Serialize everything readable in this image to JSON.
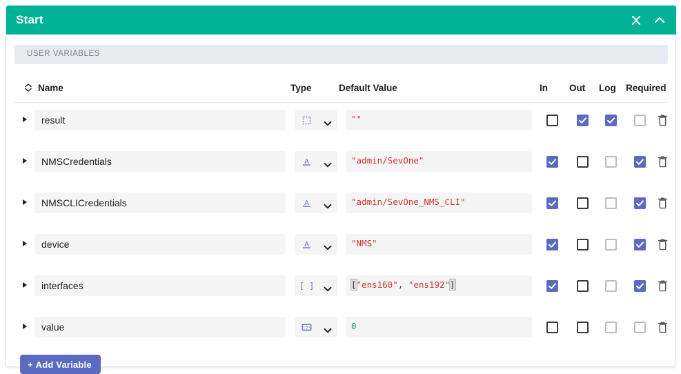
{
  "header": {
    "title": "Start",
    "accent_color": "#00b296",
    "collapse_all_icon": "collapse-all-icon",
    "collapse_panel_icon": "chevron-up-icon"
  },
  "section": {
    "label": "USER VARIABLES"
  },
  "columns": {
    "sort_icon": "sort-collapse-icon",
    "name": "Name",
    "type": "Type",
    "default_value": "Default Value",
    "in": "In",
    "out": "Out",
    "log": "Log",
    "required": "Required"
  },
  "colors": {
    "accent": "#00b296",
    "checkbox_checked": "#5c6bc0",
    "button": "#5c6bc0",
    "string_token": "#d0353a",
    "number_token": "#0f9d6e",
    "band": "#e8eaf2",
    "field": "#f5f5f5"
  },
  "rows": [
    {
      "name": "result",
      "type_icon": "type-any-icon",
      "value_tokens": [
        {
          "t": "str",
          "s": "\"\""
        }
      ],
      "value_text": "\"\"",
      "in": false,
      "out": true,
      "log": true,
      "required": false,
      "in_dim": false,
      "out_dim": false,
      "log_dim": false,
      "required_dim": true,
      "delete_icon": "trash-icon",
      "expand_icon": "expand-arrow-icon"
    },
    {
      "name": "NMSCredentials",
      "type_icon": "type-string-icon",
      "value_tokens": [
        {
          "t": "str",
          "s": "\"admin/SevOne\""
        }
      ],
      "value_text": "\"admin/SevOne\"",
      "in": true,
      "out": false,
      "log": false,
      "required": true,
      "in_dim": false,
      "out_dim": false,
      "log_dim": true,
      "required_dim": false,
      "delete_icon": "trash-icon",
      "expand_icon": "expand-arrow-icon"
    },
    {
      "name": "NMSCLICredentials",
      "type_icon": "type-string-icon",
      "value_tokens": [
        {
          "t": "str",
          "s": "\"admin/SevOne_NMS_CLI\""
        }
      ],
      "value_text": "\"admin/SevOne_NMS_CLI\"",
      "in": true,
      "out": false,
      "log": false,
      "required": true,
      "in_dim": false,
      "out_dim": false,
      "log_dim": true,
      "required_dim": false,
      "delete_icon": "trash-icon",
      "expand_icon": "expand-arrow-icon"
    },
    {
      "name": "device",
      "type_icon": "type-string-icon",
      "value_tokens": [
        {
          "t": "str",
          "s": "\"NMS\""
        }
      ],
      "value_text": "\"NMS\"",
      "in": true,
      "out": false,
      "log": false,
      "required": true,
      "in_dim": false,
      "out_dim": false,
      "log_dim": true,
      "required_dim": false,
      "delete_icon": "trash-icon",
      "expand_icon": "expand-arrow-icon"
    },
    {
      "name": "interfaces",
      "type_icon": "type-array-icon",
      "value_tokens": [
        {
          "t": "brk",
          "s": "["
        },
        {
          "t": "str",
          "s": "\"ens160\""
        },
        {
          "t": "plain",
          "s": ", "
        },
        {
          "t": "str",
          "s": "\"ens192\""
        },
        {
          "t": "brk",
          "s": "]"
        }
      ],
      "value_text": "[\"ens160\", \"ens192\"]",
      "in": true,
      "out": false,
      "log": false,
      "required": true,
      "in_dim": false,
      "out_dim": false,
      "log_dim": true,
      "required_dim": false,
      "delete_icon": "trash-icon",
      "expand_icon": "expand-arrow-icon"
    },
    {
      "name": "value",
      "type_icon": "type-number-icon",
      "value_tokens": [
        {
          "t": "num",
          "s": "0"
        }
      ],
      "value_text": "0",
      "in": false,
      "out": false,
      "log": false,
      "required": false,
      "in_dim": false,
      "out_dim": false,
      "log_dim": true,
      "required_dim": true,
      "delete_icon": "trash-icon",
      "expand_icon": "expand-arrow-icon"
    }
  ],
  "add_button": {
    "label": "Add Variable",
    "plus_icon": "plus-icon"
  }
}
